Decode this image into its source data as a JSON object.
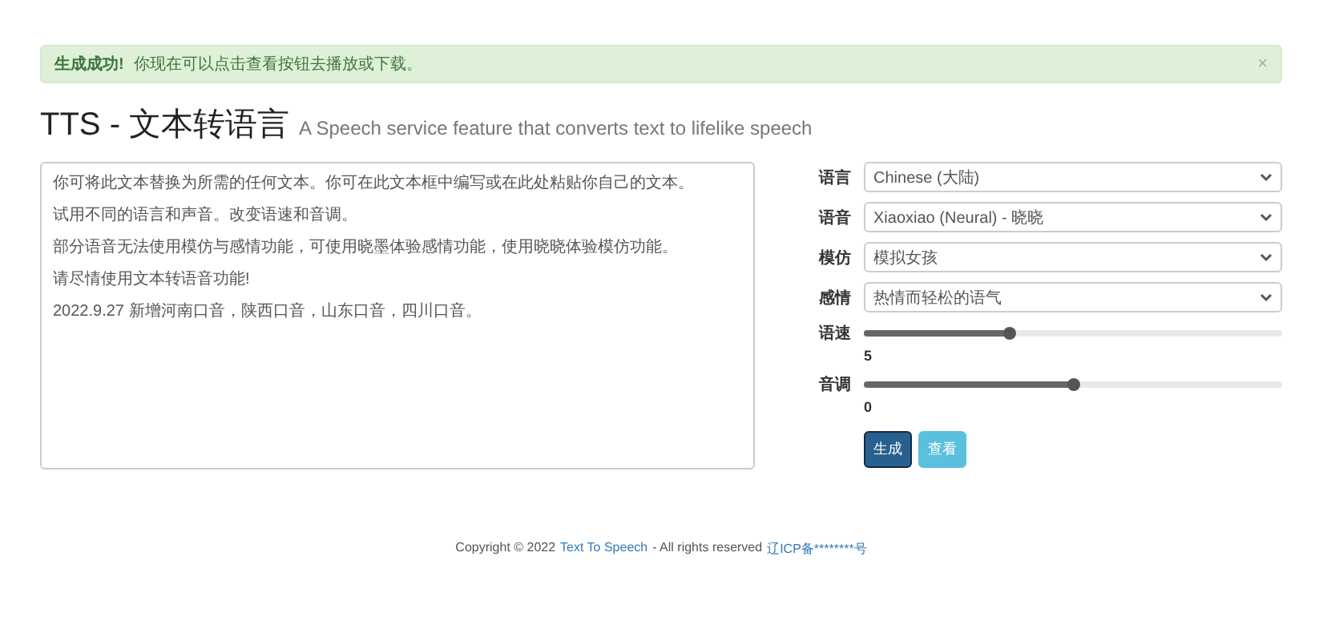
{
  "alert": {
    "strong": "生成成功!",
    "message": "你现在可以点击查看按钮去播放或下载。",
    "close": "×"
  },
  "header": {
    "title": "TTS - 文本转语言",
    "subtitle": "A Speech service feature that converts text to lifelike speech"
  },
  "text_input": {
    "lines": [
      "你可将此文本替换为所需的任何文本。你可在此文本框中编写或在此处粘贴你自己的文本。",
      "试用不同的语言和声音。改变语速和音调。",
      "部分语音无法使用模仿与感情功能，可使用晓墨体验感情功能，使用晓晓体验模仿功能。",
      "请尽情使用文本转语音功能!",
      "2022.9.27 新增河南口音，陕西口音，山东口音，四川口音。"
    ]
  },
  "settings": [
    {
      "kind": "select",
      "label": "语言",
      "value": "Chinese (大陆)"
    },
    {
      "kind": "select",
      "label": "语音",
      "value": "Xiaoxiao (Neural) - 晓晓"
    },
    {
      "kind": "select",
      "label": "模仿",
      "value": "模拟女孩"
    },
    {
      "kind": "select",
      "label": "感情",
      "value": "热情而轻松的语气"
    },
    {
      "kind": "slider",
      "label": "语速",
      "level": 0.35,
      "reading": "5"
    },
    {
      "kind": "slider",
      "label": "音调",
      "level": 0.5,
      "reading": "0"
    }
  ],
  "buttons": [
    {
      "label": "生成",
      "kind": "primary"
    },
    {
      "label": "查看",
      "kind": "info"
    }
  ],
  "footer": {
    "prefix": "Copyright © 2022",
    "link": "Text To Speech",
    "suffix": "- All rights reserved",
    "icp": "辽ICP备********号"
  }
}
